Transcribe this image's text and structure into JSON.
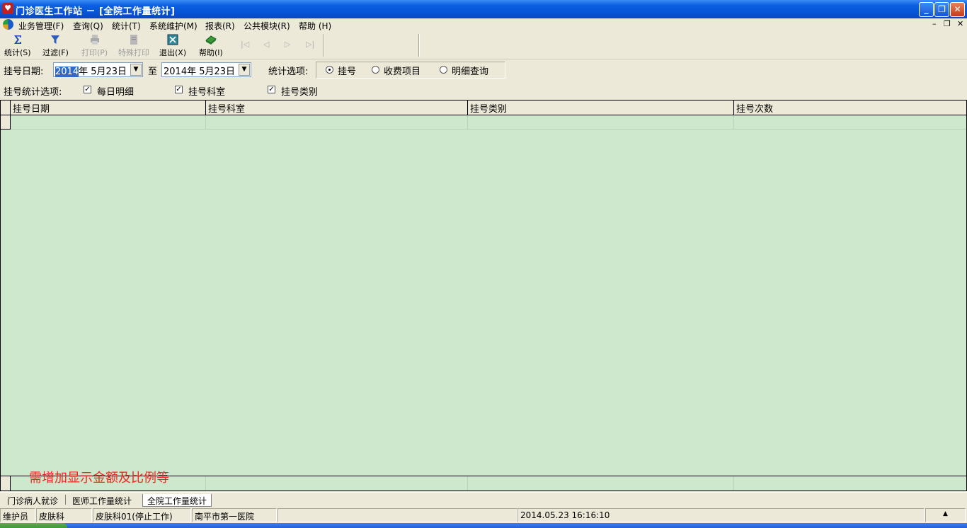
{
  "window": {
    "title": "门诊医生工作站 － [全院工作量统计]",
    "minimize": "_",
    "restore": "❐",
    "close": "✕"
  },
  "menu": {
    "items": [
      "业务管理(F)",
      "查询(Q)",
      "统计(T)",
      "系统维护(M)",
      "报表(R)",
      "公共模块(R)",
      "帮助 (H)"
    ],
    "mdi_minimize": "–",
    "mdi_restore": "❐",
    "mdi_close": "✕"
  },
  "toolbar": {
    "stats": "统计(S)",
    "filter": "过滤(F)",
    "print": "打印(P)",
    "special_print": "特殊打印",
    "exit": "退出(X)",
    "help": "帮助(I)",
    "nav_first": "|◁",
    "nav_prev": "◁",
    "nav_next": "▷",
    "nav_last": "▷|"
  },
  "filter": {
    "date_label": "挂号日期:",
    "date_from_year": "2014",
    "date_from_rest": "年  5月23日",
    "to_label": "至",
    "date_to": "2014年  5月23日",
    "options_label": "统计选项:",
    "radio_options": [
      {
        "label": "挂号",
        "selected": true
      },
      {
        "label": "收费项目",
        "selected": false
      },
      {
        "label": "明细查询",
        "selected": false
      }
    ],
    "reg_options_label": "挂号统计选项:",
    "checkboxes": [
      {
        "label": "每日明细",
        "checked": true
      },
      {
        "label": "挂号科室",
        "checked": true
      },
      {
        "label": "挂号类别",
        "checked": true
      }
    ]
  },
  "grid": {
    "columns": [
      "挂号日期",
      "挂号科室",
      "挂号类别",
      "挂号次数"
    ],
    "rows": [],
    "note": "需增加显示金额及比例等",
    "background": "#cde8cd"
  },
  "tabs": [
    "门诊病人就诊",
    "医师工作量统计",
    "全院工作量统计"
  ],
  "status": {
    "user": "维护员",
    "dept": "皮肤科",
    "room": "皮肤科01(停止工作)",
    "hospital": "南平市第一医院",
    "datetime": "2014.05.23 16:16:10"
  }
}
